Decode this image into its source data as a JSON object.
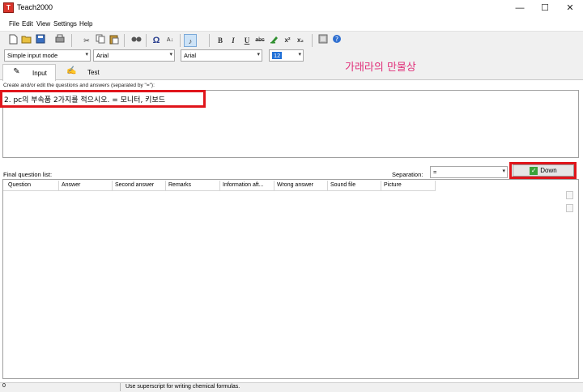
{
  "window": {
    "title": "Teach2000",
    "app_icon": "T",
    "minimize": "—",
    "maximize": "☐",
    "close": "✕"
  },
  "menu": [
    "File",
    "Edit",
    "View",
    "Settings",
    "Help"
  ],
  "toolbar": {
    "icons": [
      "new-file-icon",
      "open-folder-icon",
      "save-icon",
      "print-icon",
      "cut-icon",
      "copy-icon",
      "paste-icon",
      "find-icon",
      "omega-icon",
      "sort-icon",
      "music-note-icon",
      "bold-icon",
      "italic-icon",
      "underline-icon",
      "strikethrough-icon",
      "highlight-icon",
      "superscript-icon",
      "subscript-icon",
      "image-icon",
      "help-icon"
    ],
    "bold": "B",
    "italic": "I",
    "underline": "U",
    "strike": "abc",
    "superscript": "x²",
    "subscript": "x₂",
    "omega": "Ω"
  },
  "combos": {
    "mode": "Simple input mode",
    "font1": "Arial",
    "font2": "Arial",
    "size": "12"
  },
  "tabs": [
    {
      "label": "Input"
    },
    {
      "label": "Test"
    }
  ],
  "watermark": "가래라의 만물상",
  "editor": {
    "label": "Create and/or edit the questions and answers (separated by \"=\"):",
    "text": "2. pc의 부속품 2가지를 적으시오. = 모니터, 키보드"
  },
  "list": {
    "label": "Final question list:",
    "separation_label": "Separation:",
    "separation_value": "=",
    "down_button": "Down",
    "columns": [
      "Question",
      "Answer",
      "Second answer",
      "Remarks",
      "Information aft...",
      "Wrong answer",
      "Sound file",
      "Picture"
    ]
  },
  "status": {
    "count": "0",
    "hint": "Use superscript for writing chemical formulas."
  }
}
